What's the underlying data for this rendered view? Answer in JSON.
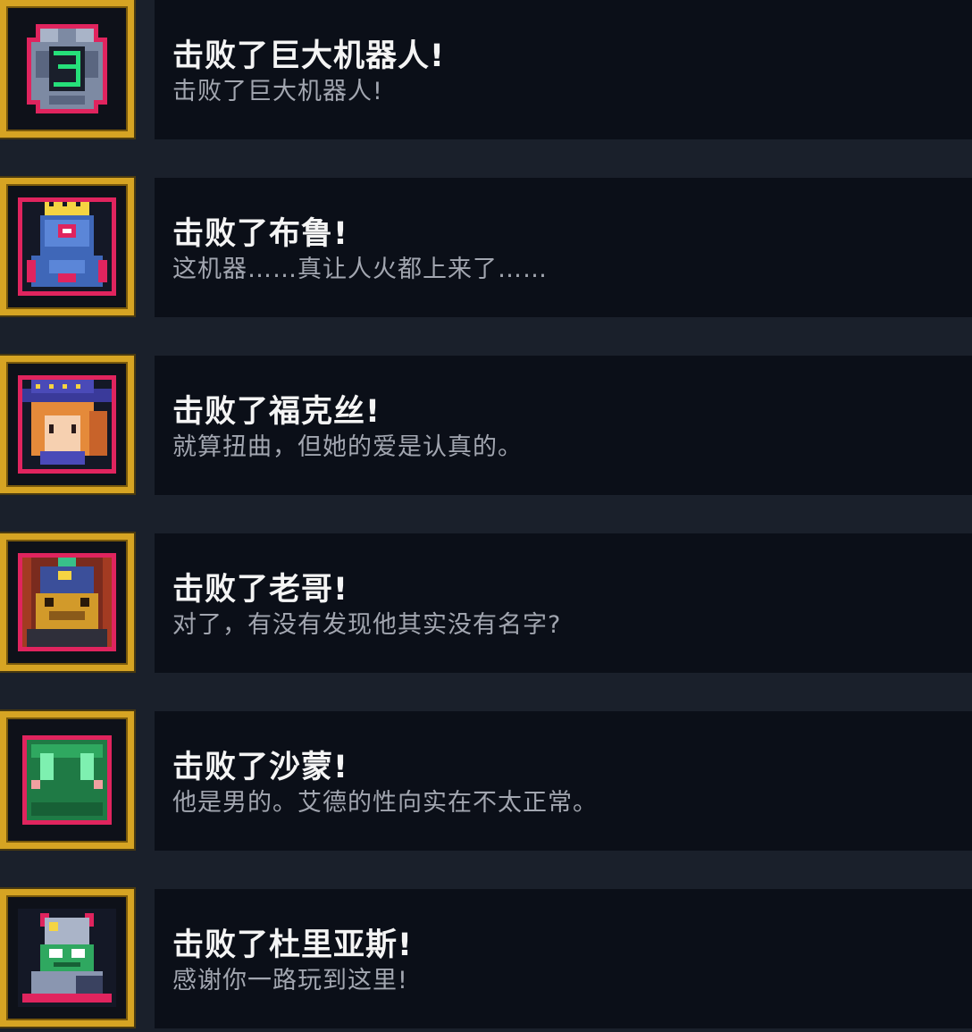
{
  "achievements": [
    {
      "icon": "giant-robot-icon",
      "title": "击败了巨大机器人!",
      "description": "击败了巨大机器人!"
    },
    {
      "icon": "blue-robot-king-icon",
      "title": "击败了布鲁!",
      "description": "这机器……真让人火都上来了……"
    },
    {
      "icon": "fox-girl-icon",
      "title": "击败了福克丝!",
      "description": "就算扭曲，但她的爱是认真的。"
    },
    {
      "icon": "old-brother-icon",
      "title": "击败了老哥!",
      "description": "对了，有没有发现他其实没有名字?"
    },
    {
      "icon": "green-slime-icon",
      "title": "击败了沙蒙!",
      "description": "他是男的。艾德的性向实在不太正常。"
    },
    {
      "icon": "dulias-knight-icon",
      "title": "击败了杜里亚斯!",
      "description": "感谢你一路玩到这里!"
    }
  ],
  "colors": {
    "background": "#1a202b",
    "panel": "#0b0f18",
    "frame_gold": "#d6a423",
    "title_text": "#f4f4f4",
    "desc_text": "#a2a6b0",
    "portrait_border": "#e0245e"
  }
}
